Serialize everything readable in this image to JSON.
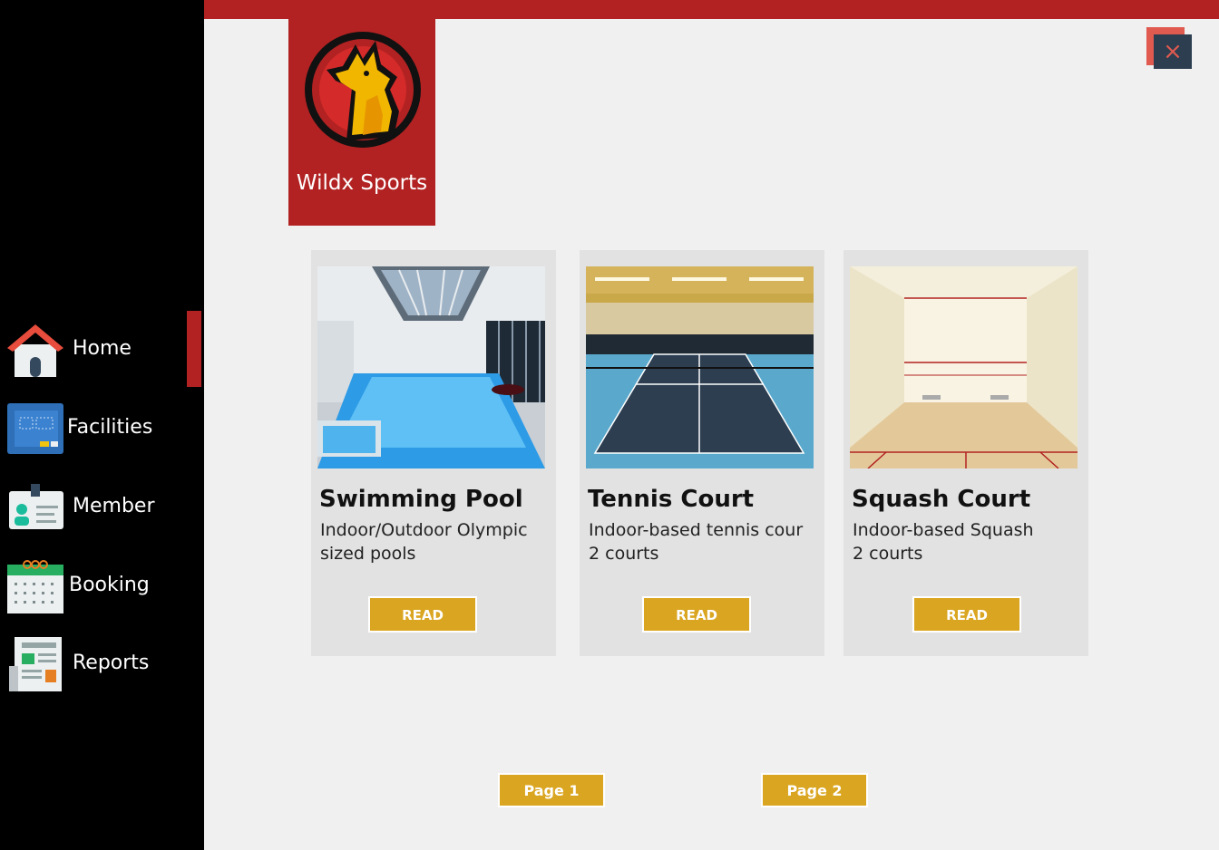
{
  "sidebar": {
    "items": [
      {
        "label": "Home",
        "icon": "home-icon",
        "active": true
      },
      {
        "label": "Facilities",
        "icon": "blueprint-icon",
        "active": false
      },
      {
        "label": "Member",
        "icon": "id-card-icon",
        "active": false
      },
      {
        "label": "Booking",
        "icon": "calendar-icon",
        "active": false
      },
      {
        "label": "Reports",
        "icon": "newspaper-icon",
        "active": false
      }
    ]
  },
  "brand": {
    "name": "Wildx Sports",
    "logo": "wolf-crest-logo",
    "color": "#b22222"
  },
  "window": {
    "close_icon": "close-icon",
    "close_glyph": "×"
  },
  "facilities": [
    {
      "title": "Swimming Pool",
      "desc_line1": "Indoor/Outdoor Olympic",
      "desc_line2": "sized pools",
      "button": "READ"
    },
    {
      "title": "Tennis Court",
      "desc_line1": "Indoor-based tennis cour",
      "desc_line2": "2 courts",
      "button": "READ"
    },
    {
      "title": "Squash Court",
      "desc_line1": "Indoor-based Squash",
      "desc_line2": "2 courts",
      "button": "READ"
    }
  ],
  "pagination": {
    "page1": "Page 1",
    "page2": "Page 2"
  },
  "colors": {
    "accent": "#b22222",
    "button": "#daa520",
    "sidebar": "#000000"
  }
}
